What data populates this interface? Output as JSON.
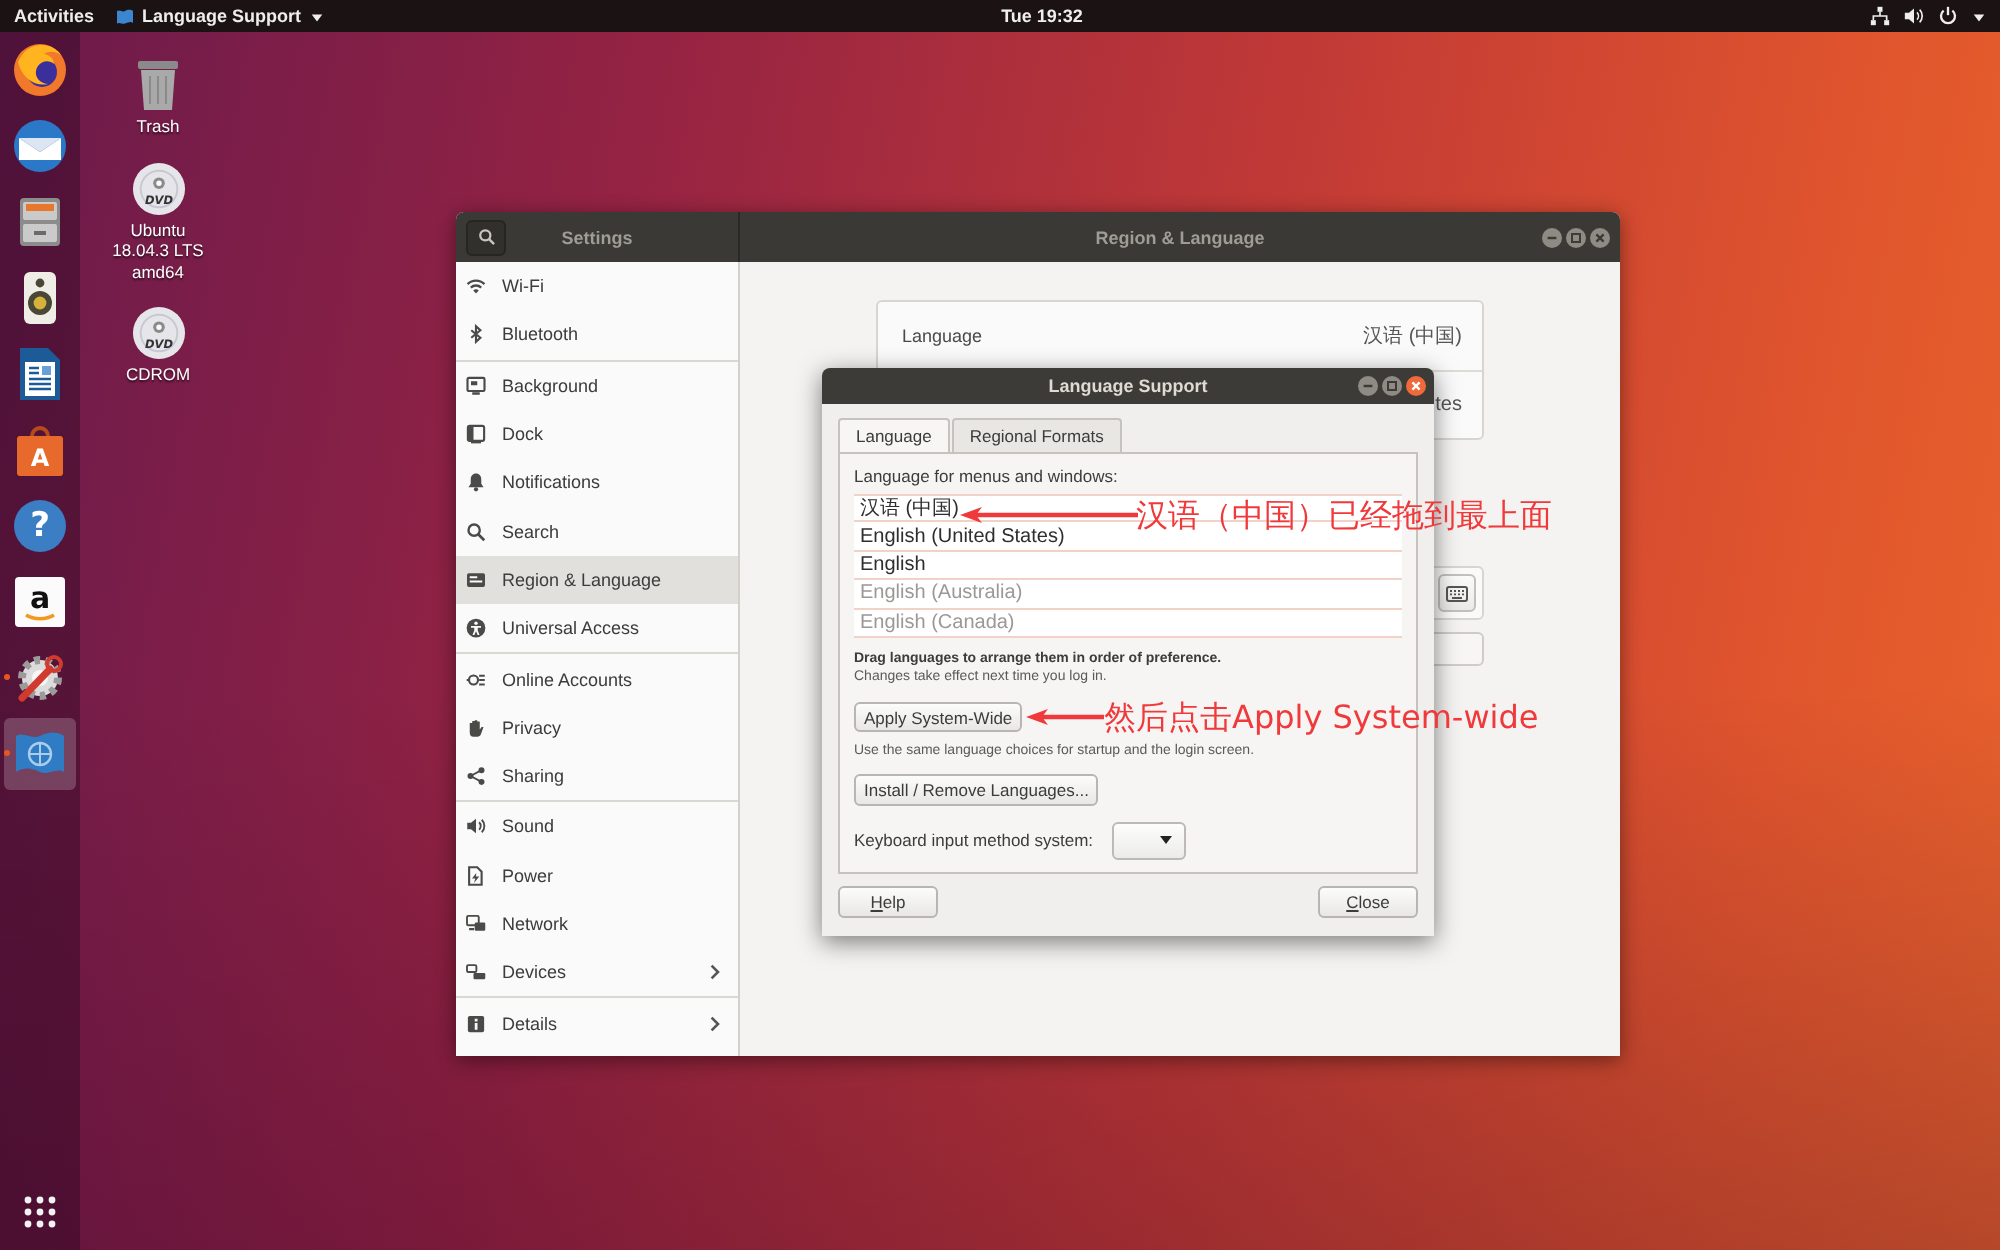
{
  "top_bar": {
    "activities": "Activities",
    "app_menu": "Language Support",
    "clock": "Tue 19:32"
  },
  "dock": {
    "items": [
      {
        "kind": "browser",
        "running": false,
        "selected": false
      },
      {
        "kind": "mail",
        "running": false,
        "selected": false
      },
      {
        "kind": "files",
        "running": false,
        "selected": false
      },
      {
        "kind": "speaker",
        "running": false,
        "selected": false
      },
      {
        "kind": "document",
        "running": false,
        "selected": false
      },
      {
        "kind": "bag",
        "glyph": "A",
        "running": false,
        "selected": false
      },
      {
        "kind": "help",
        "glyph": "?",
        "running": false,
        "selected": false
      },
      {
        "kind": "tile",
        "glyph": "a",
        "running": false,
        "selected": false
      },
      {
        "kind": "updater",
        "running": true,
        "selected": false
      },
      {
        "kind": "flag",
        "running": true,
        "selected": true
      }
    ]
  },
  "desktop_icons": [
    {
      "kind": "trash",
      "label": "Trash"
    },
    {
      "kind": "disc",
      "disc_label": "DVD",
      "label": "Ubuntu 18.04.3 LTS amd64"
    },
    {
      "kind": "disc",
      "disc_label": "DVD",
      "label": "CDROM"
    }
  ],
  "settings_window": {
    "focused": false,
    "sidebar_title": "Settings",
    "title": "Region & Language",
    "sidebar": {
      "groups": [
        {
          "items": [
            {
              "kind": "wifi",
              "label": "Wi-Fi",
              "selected": false,
              "submenu": false
            },
            {
              "kind": "bluetooth",
              "label": "Bluetooth",
              "selected": false,
              "submenu": false
            }
          ]
        },
        {
          "items": [
            {
              "kind": "background",
              "label": "Background",
              "selected": false,
              "submenu": false
            },
            {
              "kind": "dock",
              "label": "Dock",
              "selected": false,
              "submenu": false
            },
            {
              "kind": "notifications",
              "label": "Notifications",
              "selected": false,
              "submenu": false
            },
            {
              "kind": "search",
              "label": "Search",
              "selected": false,
              "submenu": false
            },
            {
              "kind": "region",
              "label": "Region & Language",
              "selected": true,
              "submenu": false
            },
            {
              "kind": "access",
              "label": "Universal Access",
              "selected": false,
              "submenu": false
            }
          ]
        },
        {
          "items": [
            {
              "kind": "accounts",
              "label": "Online Accounts",
              "selected": false,
              "submenu": false
            },
            {
              "kind": "privacy",
              "label": "Privacy",
              "selected": false,
              "submenu": false
            },
            {
              "kind": "sharing",
              "label": "Sharing",
              "selected": false,
              "submenu": false
            }
          ]
        },
        {
          "items": [
            {
              "kind": "sound",
              "label": "Sound",
              "selected": false,
              "submenu": false
            },
            {
              "kind": "power",
              "label": "Power",
              "selected": false,
              "submenu": false
            },
            {
              "kind": "network",
              "label": "Network",
              "selected": false,
              "submenu": false
            },
            {
              "kind": "devices",
              "label": "Devices",
              "selected": false,
              "submenu": true
            }
          ]
        },
        {
          "items": [
            {
              "kind": "details",
              "label": "Details",
              "selected": false,
              "submenu": true
            }
          ]
        }
      ]
    },
    "language_card": {
      "rows": [
        {
          "label": "Language",
          "value": "汉语 (中国)"
        },
        {
          "value": "tes"
        }
      ]
    }
  },
  "dialog": {
    "focused": true,
    "title": "Language Support",
    "tabs": [
      {
        "label": "Language",
        "selected": true
      },
      {
        "label": "Regional Formats",
        "selected": false
      }
    ],
    "list_label": "Language for menus and windows:",
    "languages": [
      {
        "name": "汉语 (中国)",
        "disabled": false
      },
      {
        "name": "English (United States)",
        "disabled": false
      },
      {
        "name": "English",
        "disabled": false
      },
      {
        "name": "English (Australia)",
        "disabled": true
      },
      {
        "name": "English (Canada)",
        "disabled": true
      }
    ],
    "drag_hint": "Drag languages to arrange them in order of preference.",
    "note": "Changes take effect next time you log in.",
    "apply_button": "Apply System-Wide",
    "apply_hint": "Use the same language choices for startup and the login screen.",
    "install_button": "Install / Remove Languages...",
    "input_method_label": "Keyboard input method system:",
    "buttons": [
      {
        "label": "Help"
      },
      {
        "label": "Close"
      }
    ]
  },
  "annotations": [
    {
      "text": "汉语（中国）已经拖到最上面"
    },
    {
      "text": "然后点击Apply System-wide"
    }
  ]
}
